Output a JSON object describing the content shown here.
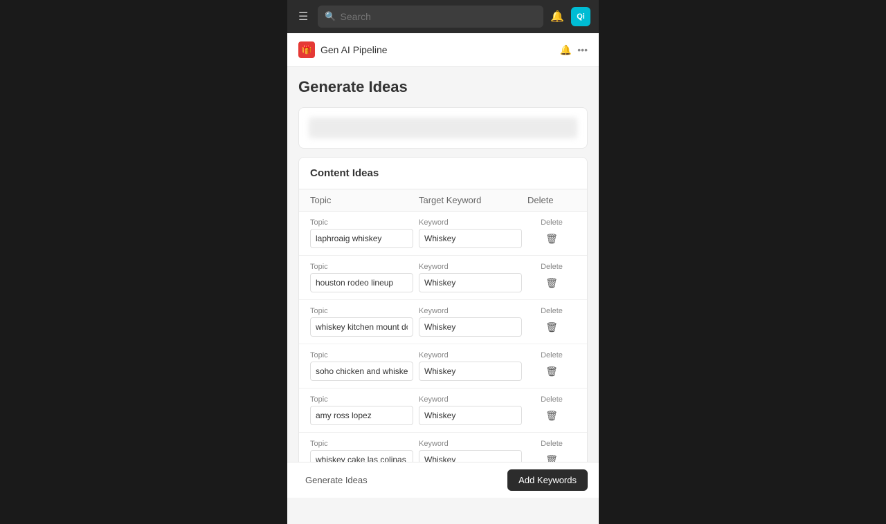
{
  "nav": {
    "search_placeholder": "Search",
    "avatar_initials": "Qi"
  },
  "page_header": {
    "app_icon": "🎁",
    "title": "Gen AI Pipeline"
  },
  "main": {
    "title": "Generate Ideas",
    "content_ideas": {
      "section_title": "Content Ideas",
      "columns": {
        "topic": "Topic",
        "keyword": "Target Keyword",
        "delete": "Delete"
      },
      "rows": [
        {
          "topic_label": "Topic",
          "topic_value": "laphroaig whiskey",
          "keyword_label": "Keyword",
          "keyword_value": "Whiskey"
        },
        {
          "topic_label": "Topic",
          "topic_value": "houston rodeo lineup",
          "keyword_label": "Keyword",
          "keyword_value": "Whiskey"
        },
        {
          "topic_label": "Topic",
          "topic_value": "whiskey kitchen mount dora",
          "keyword_label": "Keyword",
          "keyword_value": "Whiskey"
        },
        {
          "topic_label": "Topic",
          "topic_value": "soho chicken and whiskey",
          "keyword_label": "Keyword",
          "keyword_value": "Whiskey"
        },
        {
          "topic_label": "Topic",
          "topic_value": "amy ross lopez",
          "keyword_label": "Keyword",
          "keyword_value": "Whiskey"
        },
        {
          "topic_label": "Topic",
          "topic_value": "whiskey cake las colinas",
          "keyword_label": "Keyword",
          "keyword_value": "Whiskey"
        }
      ]
    }
  },
  "footer": {
    "generate_ideas_label": "Generate Ideas",
    "add_keywords_label": "Add Keywords"
  },
  "delete_labels": [
    "Delete",
    "Delete",
    "Delete",
    "Delete",
    "Delete",
    "Delete"
  ]
}
